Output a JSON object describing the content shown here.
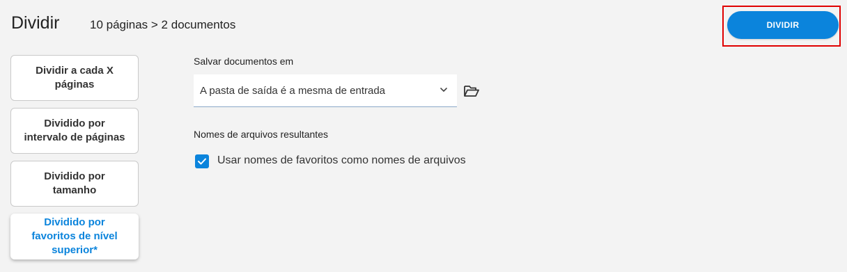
{
  "header": {
    "title": "Dividir",
    "summary": "10 páginas > 2 documentos",
    "primary_button": "DIVIDIR"
  },
  "modes": [
    {
      "label": "Dividir a cada X páginas",
      "selected": false
    },
    {
      "label": "Dividido por intervalo de páginas",
      "selected": false
    },
    {
      "label": "Dividido por tamanho",
      "selected": false
    },
    {
      "label": "Dividido por favoritos de nível superior*",
      "selected": true
    }
  ],
  "save": {
    "label": "Salvar documentos em",
    "selected_option": "A pasta de saída é a mesma de entrada",
    "folder_icon": "open-folder-icon"
  },
  "filenames": {
    "label": "Nomes de arquivos resultantes",
    "checkbox_label": "Usar nomes de favoritos como nomes de arquivos",
    "checked": true
  },
  "colors": {
    "accent": "#0b84dc",
    "highlight_outline": "#e00000",
    "background": "#f3f3f3"
  }
}
